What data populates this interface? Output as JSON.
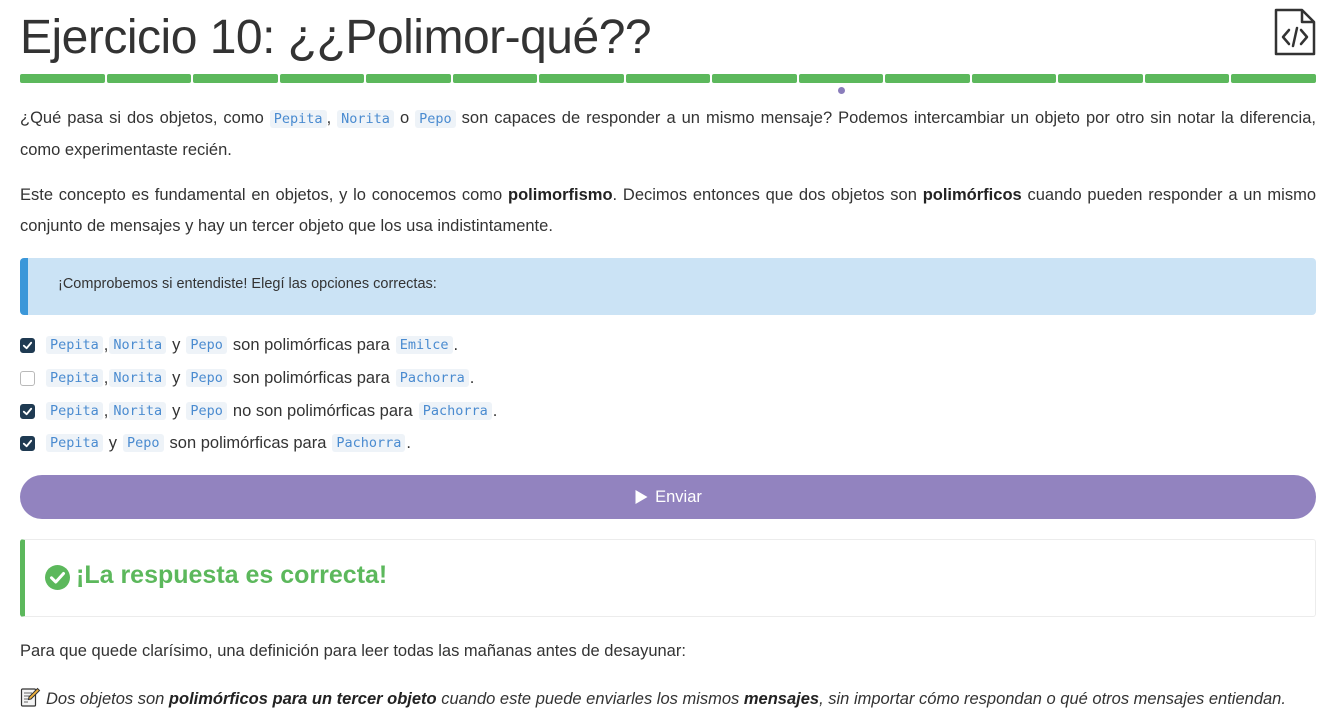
{
  "header": {
    "title": "Ejercicio 10: ¿¿Polimor-qué??",
    "progress_total": 15,
    "progress_current_index": 9,
    "colors": {
      "progress": "#5cb85c",
      "indicator": "#8a7dbb"
    }
  },
  "intro": {
    "p1_pre": "¿Qué pasa si dos objetos, como ",
    "p1_code1": "Pepita",
    "p1_sep1": ", ",
    "p1_code2": "Norita",
    "p1_sep2": " o ",
    "p1_code3": "Pepo",
    "p1_post": " son capaces de responder a un mismo mensaje? Podemos intercambiar un objeto por otro sin notar la diferencia, como experimentaste recién.",
    "p2_pre": "Este concepto es fundamental en objetos, y lo conocemos como ",
    "p2_bold1": "polimorfismo",
    "p2_mid": ". Decimos entonces que dos objetos son ",
    "p2_bold2": "polimórficos",
    "p2_post": " cuando pueden responder a un mismo conjunto de mensajes y hay un tercer objeto que los usa indistintamente."
  },
  "info": {
    "text": "¡Comprobemos si entendiste! Elegí las opciones correctas:"
  },
  "options": [
    {
      "checked": true,
      "a": "Pepita",
      "s1": ",",
      "b": "Norita",
      "y": "y",
      "c": "Pepo",
      "text": "son polimórficas para",
      "target": "Emilce",
      "end": "."
    },
    {
      "checked": false,
      "a": "Pepita",
      "s1": ",",
      "b": "Norita",
      "y": "y",
      "c": "Pepo",
      "text": "son polimórficas para",
      "target": "Pachorra",
      "end": "."
    },
    {
      "checked": true,
      "a": "Pepita",
      "s1": ",",
      "b": "Norita",
      "y": "y",
      "c": "Pepo",
      "text": "no son polimórficas para",
      "target": "Pachorra",
      "end": "."
    },
    {
      "checked": true,
      "a": "Pepita",
      "y": "y",
      "c": "Pepo",
      "text": "son polimórficas para",
      "target": "Pachorra",
      "end": "."
    }
  ],
  "send_button": {
    "label": "Enviar",
    "icon": "play-icon"
  },
  "result": {
    "text": "¡La respuesta es correcta!",
    "icon": "check-circle-icon"
  },
  "outro": {
    "text": "Para que quede clarísimo, una definición para leer todas las mañanas antes de desayunar:",
    "def_pre": "Dos objetos son ",
    "def_bold1": "polimórficos para un tercer objeto",
    "def_mid": " cuando este puede enviarles los mismos ",
    "def_bold2": "mensajes",
    "def_post": ", sin importar cómo respondan o qué otros mensajes entiendan.",
    "icon": "memo-icon"
  }
}
